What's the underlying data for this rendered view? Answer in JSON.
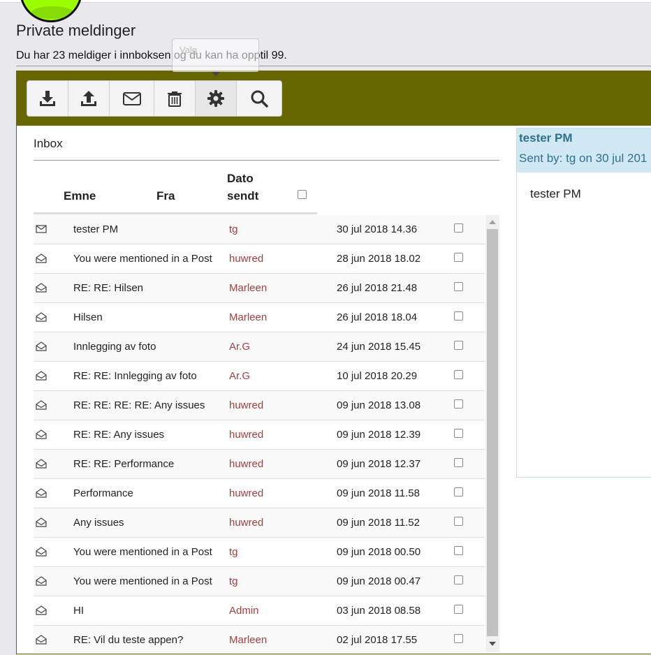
{
  "header": {
    "page_title": "Private meldinger",
    "info_text": "Du har 23 meldiger i innboksen og du kan ha opptil 99.",
    "tooltip": "Valg"
  },
  "toolbar": {
    "buttons": [
      {
        "icon": "download-icon"
      },
      {
        "icon": "upload-icon"
      },
      {
        "icon": "envelope-icon"
      },
      {
        "icon": "trash-icon"
      },
      {
        "icon": "gear-icon"
      },
      {
        "icon": "search-icon"
      }
    ],
    "background": "#666600"
  },
  "inbox": {
    "label": "Inbox",
    "columns": {
      "subject": "Emne",
      "from": "Fra",
      "date_line1": "Dato",
      "date_line2": "sendt"
    },
    "rows": [
      {
        "subject": "tester PM",
        "from": "tg",
        "date": "30 jul 2018 14.36",
        "read": false
      },
      {
        "subject": "You were mentioned in a Post",
        "from": "huwred",
        "date": "28 jun 2018 18.02",
        "read": true
      },
      {
        "subject": "RE: RE: Hilsen",
        "from": "Marleen",
        "date": "26 jul 2018 21.48",
        "read": true
      },
      {
        "subject": "Hilsen",
        "from": "Marleen",
        "date": "26 jul 2018 18.04",
        "read": true
      },
      {
        "subject": "Innlegging av foto",
        "from": "Ar.G",
        "date": "24 jun 2018 15.45",
        "read": true
      },
      {
        "subject": "RE: RE: Innlegging av foto",
        "from": "Ar.G",
        "date": "10 jul 2018 20.29",
        "read": true
      },
      {
        "subject": "RE: RE: RE: RE: Any issues",
        "from": "huwred",
        "date": "09 jun 2018 13.08",
        "read": true
      },
      {
        "subject": "RE: RE: Any issues",
        "from": "huwred",
        "date": "09 jun 2018 12.39",
        "read": true
      },
      {
        "subject": "RE: RE: Performance",
        "from": "huwred",
        "date": "09 jun 2018 12.37",
        "read": true
      },
      {
        "subject": "Performance",
        "from": "huwred",
        "date": "09 jun 2018 11.58",
        "read": true
      },
      {
        "subject": "Any issues",
        "from": "huwred",
        "date": "09 jun 2018 11.52",
        "read": true
      },
      {
        "subject": "You were mentioned in a Post",
        "from": "tg",
        "date": "09 jun 2018 00.50",
        "read": true
      },
      {
        "subject": "You were mentioned in a Post",
        "from": "tg",
        "date": "09 jun 2018 00.47",
        "read": true
      },
      {
        "subject": "HI",
        "from": "Admin",
        "date": "03 jun 2018 08.58",
        "read": true
      },
      {
        "subject": "RE: Vil du teste appen?",
        "from": "Marleen",
        "date": "02 jul 2018 17.55",
        "read": true
      }
    ]
  },
  "preview": {
    "title": "tester PM",
    "sent_by": "Sent by: tg on 30 jul 201",
    "body": "tester PM"
  }
}
